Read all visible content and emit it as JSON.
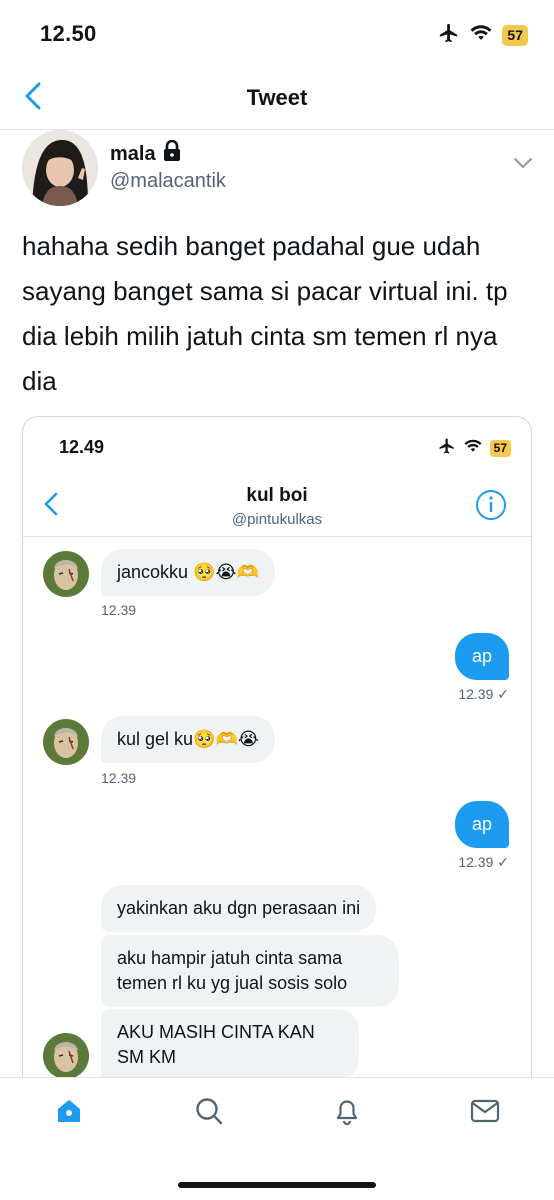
{
  "status_bar": {
    "time": "12.50",
    "battery": "57"
  },
  "header": {
    "title": "Tweet"
  },
  "author": {
    "name": "mala",
    "handle": "@malacantik"
  },
  "tweet": {
    "text": "hahaha sedih banget padahal gue udah sayang banget sama si pacar virtual ini. tp dia lebih milih jatuh cinta sm temen rl nya dia"
  },
  "screenshot": {
    "status_bar": {
      "time": "12.49",
      "battery": "57"
    },
    "header": {
      "title": "kul boi",
      "subtitle": "@pintukulkas"
    },
    "messages": [
      {
        "text": "jancokku 🥺😭🫶",
        "time": "12.39"
      },
      {
        "text": "ap",
        "time": "12.39 ✓"
      },
      {
        "text": "kul gel ku🥺🫶😭",
        "time": "12.39"
      },
      {
        "text": "ap",
        "time": "12.39 ✓"
      },
      {
        "text": "yakinkan aku dgn perasaan ini"
      },
      {
        "text": "aku hampir jatuh cinta sama temen rl ku yg jual sosis solo"
      },
      {
        "text": "AKU MASIH CINTA KAN SM KM"
      }
    ]
  },
  "icons": {
    "back": "chevron-left-icon",
    "lock": "lock-icon",
    "more": "chevron-down-icon",
    "info": "info-icon",
    "tabs": [
      "home-icon",
      "search-icon",
      "bell-icon",
      "mail-icon"
    ]
  },
  "colors": {
    "accent": "#1d9bf0",
    "bubble_in": "#eff3f4",
    "battery": "#f2c94c"
  }
}
